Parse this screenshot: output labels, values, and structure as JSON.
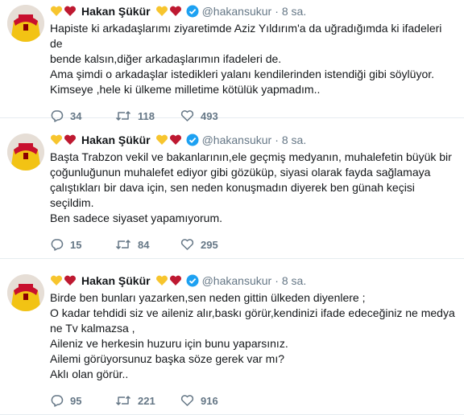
{
  "tweets": [
    {
      "author": "Hakan Şükür",
      "handle": "@hakansukur",
      "time": "8 sa.",
      "lines": [
        "Hapiste ki arkadaşlarımı ziyaretimde Aziz Yıldırım'a da uğradığımda ki ifadeleri de",
        "bende kalsın,diğer arkadaşlarımın ifadeleri de.",
        "Ama şimdi o arkadaşlar istedikleri yalanı kendilerinden istendiği gibi söylüyor.",
        "Kimseye ,hele ki ülkeme milletime kötülük yapmadım.."
      ],
      "replies": "34",
      "retweets": "118",
      "likes": "493"
    },
    {
      "author": "Hakan Şükür",
      "handle": "@hakansukur",
      "time": "8 sa.",
      "lines": [
        "Başta Trabzon vekil ve bakanlarının,ele geçmiş medyanın, muhalefetin büyük bir",
        "çoğunluğunun muhalefet ediyor gibi gözüküp, siyasi olarak fayda sağlamaya",
        "çalıştıkları bir dava için, sen neden konuşmadın diyerek ben günah keçisi",
        "seçildim.",
        "Ben sadece siyaset yapamıyorum."
      ],
      "replies": "15",
      "retweets": "84",
      "likes": "295"
    },
    {
      "author": "Hakan Şükür",
      "handle": "@hakansukur",
      "time": "8 sa.",
      "lines": [
        "Birde ben bunları yazarken,sen neden gittin ülkeden diyenlere ;",
        "O kadar tehdidi siz ve aileniz alır,baskı görür,kendinizi ifade edeceğiniz ne medya",
        "ne Tv kalmazsa ,",
        "Aileniz ve herkesin huzuru için bunu yaparsınız.",
        "Ailemi görüyorsunuz başka söze gerek var mı?",
        "Aklı olan görür.."
      ],
      "replies": "95",
      "retweets": "221",
      "likes": "916"
    }
  ],
  "icons": {
    "heart_yellow": "yellow-heart-icon",
    "heart_red": "red-heart-icon",
    "verified": "verified-badge-icon",
    "reply": "reply-icon",
    "retweet": "retweet-icon",
    "like": "like-icon"
  },
  "colors": {
    "text": "#14171a",
    "muted": "#657786",
    "verified": "#1da1f2",
    "divider": "#e6ecf0",
    "heart_yellow": "#f7c52e",
    "heart_red": "#be1931"
  }
}
